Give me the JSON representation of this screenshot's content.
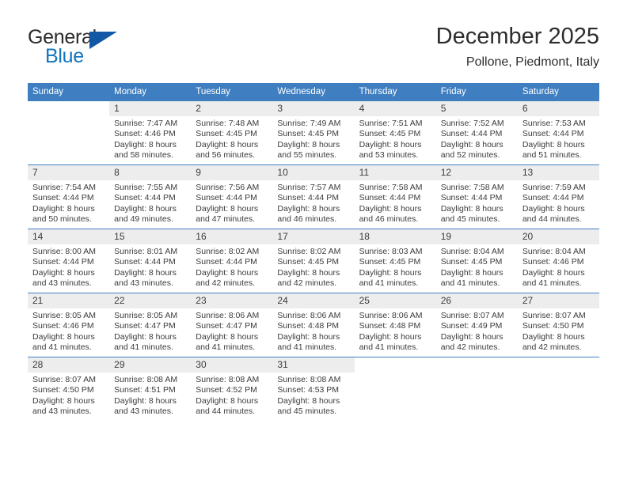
{
  "brand": {
    "name_part1": "General",
    "name_part2": "Blue",
    "logo_icon": "triangle-flag-icon"
  },
  "header": {
    "title": "December 2025",
    "subtitle": "Pollone, Piedmont, Italy"
  },
  "colors": {
    "header_blue": "#3f7fc1",
    "brand_blue": "#1275c0",
    "logo_blue": "#1159a5",
    "daynum_bg": "#ededed",
    "text": "#3b3b3b"
  },
  "weekday_headers": [
    "Sunday",
    "Monday",
    "Tuesday",
    "Wednesday",
    "Thursday",
    "Friday",
    "Saturday"
  ],
  "weeks": [
    [
      {
        "day": "",
        "sunrise": "",
        "sunset": "",
        "daylight_line1": "",
        "daylight_line2": ""
      },
      {
        "day": "1",
        "sunrise": "Sunrise: 7:47 AM",
        "sunset": "Sunset: 4:46 PM",
        "daylight_line1": "Daylight: 8 hours",
        "daylight_line2": "and 58 minutes."
      },
      {
        "day": "2",
        "sunrise": "Sunrise: 7:48 AM",
        "sunset": "Sunset: 4:45 PM",
        "daylight_line1": "Daylight: 8 hours",
        "daylight_line2": "and 56 minutes."
      },
      {
        "day": "3",
        "sunrise": "Sunrise: 7:49 AM",
        "sunset": "Sunset: 4:45 PM",
        "daylight_line1": "Daylight: 8 hours",
        "daylight_line2": "and 55 minutes."
      },
      {
        "day": "4",
        "sunrise": "Sunrise: 7:51 AM",
        "sunset": "Sunset: 4:45 PM",
        "daylight_line1": "Daylight: 8 hours",
        "daylight_line2": "and 53 minutes."
      },
      {
        "day": "5",
        "sunrise": "Sunrise: 7:52 AM",
        "sunset": "Sunset: 4:44 PM",
        "daylight_line1": "Daylight: 8 hours",
        "daylight_line2": "and 52 minutes."
      },
      {
        "day": "6",
        "sunrise": "Sunrise: 7:53 AM",
        "sunset": "Sunset: 4:44 PM",
        "daylight_line1": "Daylight: 8 hours",
        "daylight_line2": "and 51 minutes."
      }
    ],
    [
      {
        "day": "7",
        "sunrise": "Sunrise: 7:54 AM",
        "sunset": "Sunset: 4:44 PM",
        "daylight_line1": "Daylight: 8 hours",
        "daylight_line2": "and 50 minutes."
      },
      {
        "day": "8",
        "sunrise": "Sunrise: 7:55 AM",
        "sunset": "Sunset: 4:44 PM",
        "daylight_line1": "Daylight: 8 hours",
        "daylight_line2": "and 49 minutes."
      },
      {
        "day": "9",
        "sunrise": "Sunrise: 7:56 AM",
        "sunset": "Sunset: 4:44 PM",
        "daylight_line1": "Daylight: 8 hours",
        "daylight_line2": "and 47 minutes."
      },
      {
        "day": "10",
        "sunrise": "Sunrise: 7:57 AM",
        "sunset": "Sunset: 4:44 PM",
        "daylight_line1": "Daylight: 8 hours",
        "daylight_line2": "and 46 minutes."
      },
      {
        "day": "11",
        "sunrise": "Sunrise: 7:58 AM",
        "sunset": "Sunset: 4:44 PM",
        "daylight_line1": "Daylight: 8 hours",
        "daylight_line2": "and 46 minutes."
      },
      {
        "day": "12",
        "sunrise": "Sunrise: 7:58 AM",
        "sunset": "Sunset: 4:44 PM",
        "daylight_line1": "Daylight: 8 hours",
        "daylight_line2": "and 45 minutes."
      },
      {
        "day": "13",
        "sunrise": "Sunrise: 7:59 AM",
        "sunset": "Sunset: 4:44 PM",
        "daylight_line1": "Daylight: 8 hours",
        "daylight_line2": "and 44 minutes."
      }
    ],
    [
      {
        "day": "14",
        "sunrise": "Sunrise: 8:00 AM",
        "sunset": "Sunset: 4:44 PM",
        "daylight_line1": "Daylight: 8 hours",
        "daylight_line2": "and 43 minutes."
      },
      {
        "day": "15",
        "sunrise": "Sunrise: 8:01 AM",
        "sunset": "Sunset: 4:44 PM",
        "daylight_line1": "Daylight: 8 hours",
        "daylight_line2": "and 43 minutes."
      },
      {
        "day": "16",
        "sunrise": "Sunrise: 8:02 AM",
        "sunset": "Sunset: 4:44 PM",
        "daylight_line1": "Daylight: 8 hours",
        "daylight_line2": "and 42 minutes."
      },
      {
        "day": "17",
        "sunrise": "Sunrise: 8:02 AM",
        "sunset": "Sunset: 4:45 PM",
        "daylight_line1": "Daylight: 8 hours",
        "daylight_line2": "and 42 minutes."
      },
      {
        "day": "18",
        "sunrise": "Sunrise: 8:03 AM",
        "sunset": "Sunset: 4:45 PM",
        "daylight_line1": "Daylight: 8 hours",
        "daylight_line2": "and 41 minutes."
      },
      {
        "day": "19",
        "sunrise": "Sunrise: 8:04 AM",
        "sunset": "Sunset: 4:45 PM",
        "daylight_line1": "Daylight: 8 hours",
        "daylight_line2": "and 41 minutes."
      },
      {
        "day": "20",
        "sunrise": "Sunrise: 8:04 AM",
        "sunset": "Sunset: 4:46 PM",
        "daylight_line1": "Daylight: 8 hours",
        "daylight_line2": "and 41 minutes."
      }
    ],
    [
      {
        "day": "21",
        "sunrise": "Sunrise: 8:05 AM",
        "sunset": "Sunset: 4:46 PM",
        "daylight_line1": "Daylight: 8 hours",
        "daylight_line2": "and 41 minutes."
      },
      {
        "day": "22",
        "sunrise": "Sunrise: 8:05 AM",
        "sunset": "Sunset: 4:47 PM",
        "daylight_line1": "Daylight: 8 hours",
        "daylight_line2": "and 41 minutes."
      },
      {
        "day": "23",
        "sunrise": "Sunrise: 8:06 AM",
        "sunset": "Sunset: 4:47 PM",
        "daylight_line1": "Daylight: 8 hours",
        "daylight_line2": "and 41 minutes."
      },
      {
        "day": "24",
        "sunrise": "Sunrise: 8:06 AM",
        "sunset": "Sunset: 4:48 PM",
        "daylight_line1": "Daylight: 8 hours",
        "daylight_line2": "and 41 minutes."
      },
      {
        "day": "25",
        "sunrise": "Sunrise: 8:06 AM",
        "sunset": "Sunset: 4:48 PM",
        "daylight_line1": "Daylight: 8 hours",
        "daylight_line2": "and 41 minutes."
      },
      {
        "day": "26",
        "sunrise": "Sunrise: 8:07 AM",
        "sunset": "Sunset: 4:49 PM",
        "daylight_line1": "Daylight: 8 hours",
        "daylight_line2": "and 42 minutes."
      },
      {
        "day": "27",
        "sunrise": "Sunrise: 8:07 AM",
        "sunset": "Sunset: 4:50 PM",
        "daylight_line1": "Daylight: 8 hours",
        "daylight_line2": "and 42 minutes."
      }
    ],
    [
      {
        "day": "28",
        "sunrise": "Sunrise: 8:07 AM",
        "sunset": "Sunset: 4:50 PM",
        "daylight_line1": "Daylight: 8 hours",
        "daylight_line2": "and 43 minutes."
      },
      {
        "day": "29",
        "sunrise": "Sunrise: 8:08 AM",
        "sunset": "Sunset: 4:51 PM",
        "daylight_line1": "Daylight: 8 hours",
        "daylight_line2": "and 43 minutes."
      },
      {
        "day": "30",
        "sunrise": "Sunrise: 8:08 AM",
        "sunset": "Sunset: 4:52 PM",
        "daylight_line1": "Daylight: 8 hours",
        "daylight_line2": "and 44 minutes."
      },
      {
        "day": "31",
        "sunrise": "Sunrise: 8:08 AM",
        "sunset": "Sunset: 4:53 PM",
        "daylight_line1": "Daylight: 8 hours",
        "daylight_line2": "and 45 minutes."
      },
      {
        "day": "",
        "sunrise": "",
        "sunset": "",
        "daylight_line1": "",
        "daylight_line2": ""
      },
      {
        "day": "",
        "sunrise": "",
        "sunset": "",
        "daylight_line1": "",
        "daylight_line2": ""
      },
      {
        "day": "",
        "sunrise": "",
        "sunset": "",
        "daylight_line1": "",
        "daylight_line2": ""
      }
    ]
  ]
}
